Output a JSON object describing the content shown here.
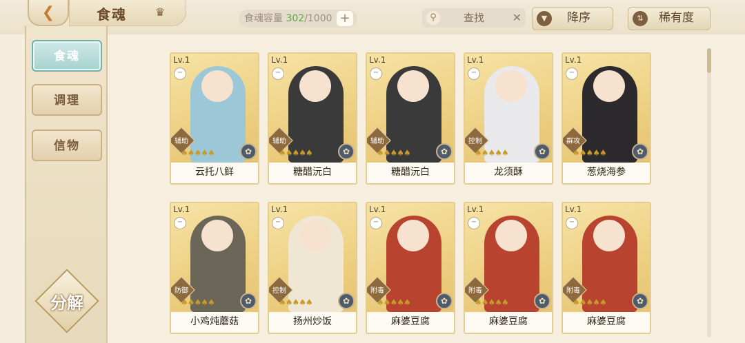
{
  "header": {
    "back_icon": "back-arrow-icon",
    "title": "食魂",
    "capacity_label": "食魂容量",
    "capacity_used": "302",
    "capacity_total": "/1000",
    "add_label": "+",
    "search_label": "查找",
    "search_clear": "✕",
    "sort_order_label": "降序",
    "sort_key_label": "稀有度"
  },
  "sidebar": {
    "tabs": [
      {
        "label": "食魂",
        "active": true
      },
      {
        "label": "调理",
        "active": false
      },
      {
        "label": "信物",
        "active": false
      }
    ],
    "decompose_label": "分解"
  },
  "cards": [
    {
      "level": "Lv.1",
      "role": "辅助",
      "name": "云托八鲜",
      "palette": "#9cc7d6"
    },
    {
      "level": "Lv.1",
      "role": "辅助",
      "name": "糖醋沅白",
      "palette": "#3a3a3a"
    },
    {
      "level": "Lv.1",
      "role": "辅助",
      "name": "糖醋沅白",
      "palette": "#3a3a3a"
    },
    {
      "level": "Lv.1",
      "role": "控制",
      "name": "龙须酥",
      "palette": "#e9e9ec"
    },
    {
      "level": "Lv.1",
      "role": "群攻",
      "name": "葱烧海参",
      "palette": "#2c2a2c"
    },
    {
      "level": "Lv.1",
      "role": "防御",
      "name": "小鸡炖蘑菇",
      "palette": "#6b6658"
    },
    {
      "level": "Lv.1",
      "role": "控制",
      "name": "扬州炒饭",
      "palette": "#efe6d4"
    },
    {
      "level": "Lv.1",
      "role": "附毒",
      "name": "麻婆豆腐",
      "palette": "#b8432e"
    },
    {
      "level": "Lv.1",
      "role": "附毒",
      "name": "麻婆豆腐",
      "palette": "#b8432e"
    },
    {
      "level": "Lv.1",
      "role": "附毒",
      "name": "麻婆豆腐",
      "palette": "#b8432e"
    }
  ],
  "card_stars": "♠♠♠♠♠",
  "card_element_icon": "✿",
  "card_equip_icon": "−"
}
